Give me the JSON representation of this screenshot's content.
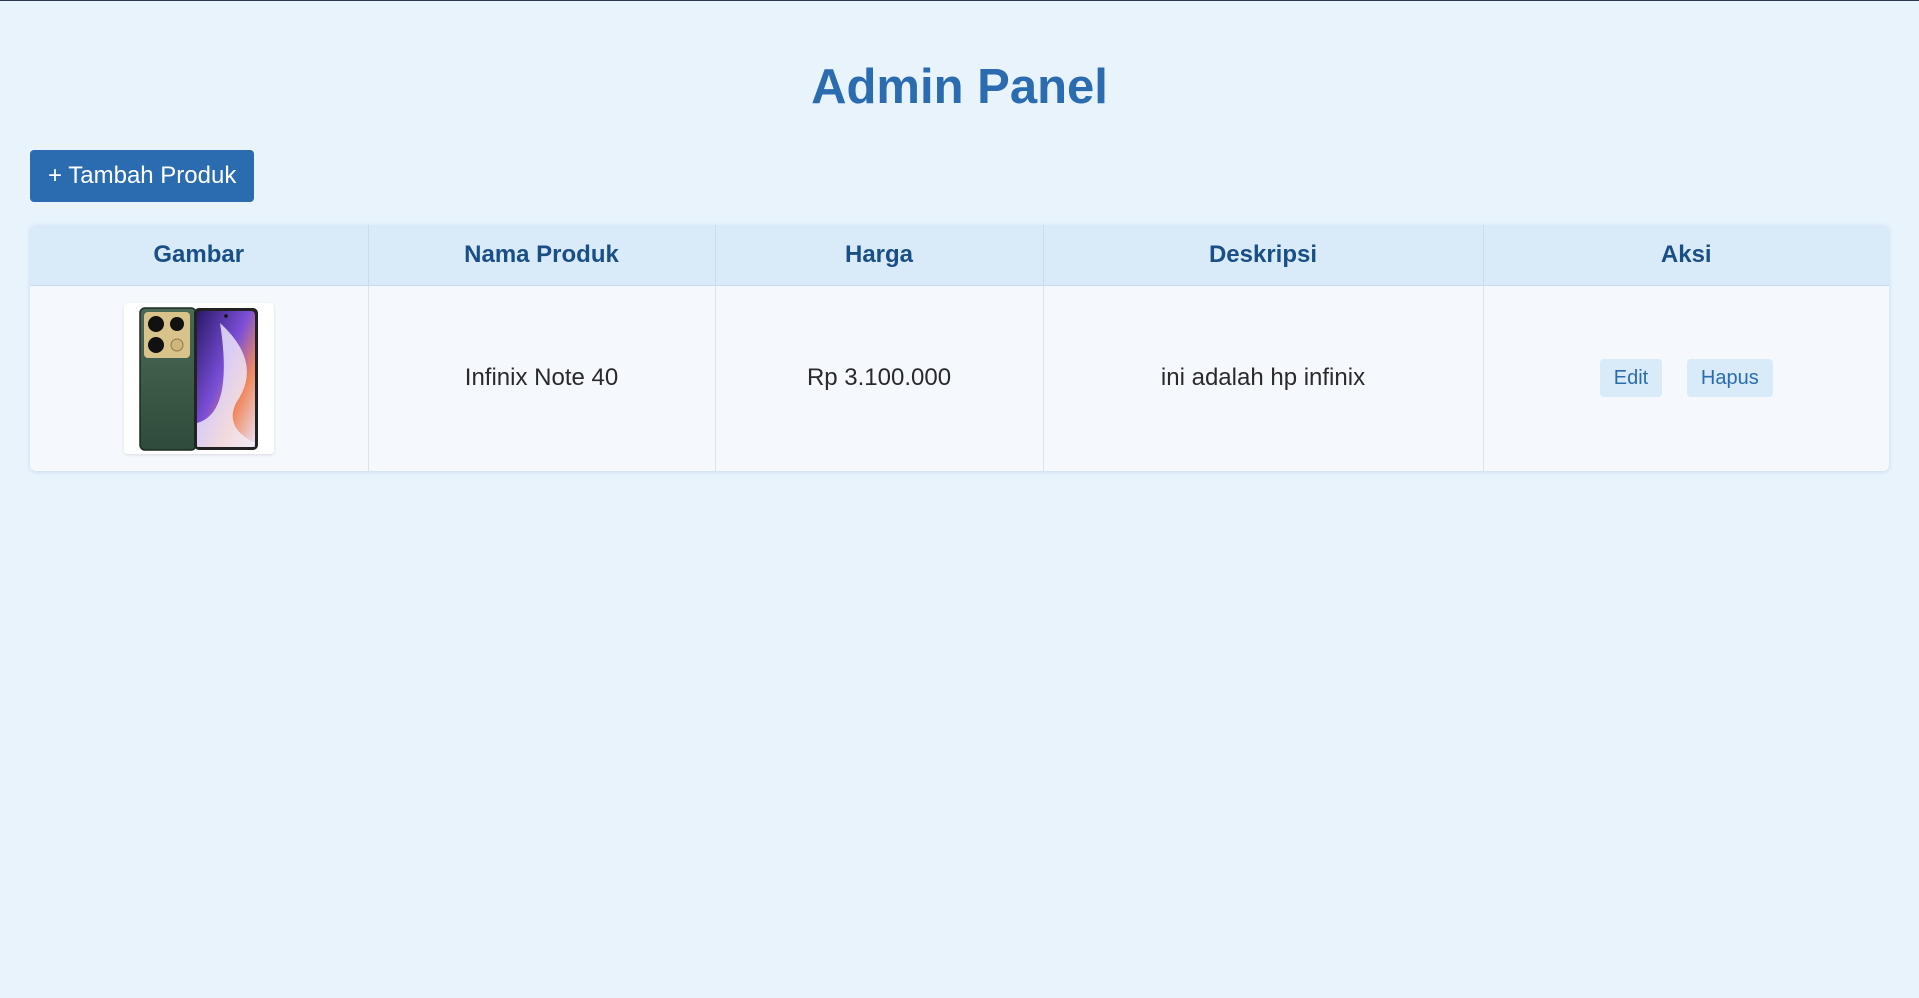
{
  "page": {
    "title": "Admin Panel"
  },
  "toolbar": {
    "add_label": "+ Tambah Produk"
  },
  "table": {
    "columns": [
      "Gambar",
      "Nama Produk",
      "Harga",
      "Deskripsi",
      "Aksi"
    ],
    "rows": [
      {
        "image_icon": "phone-image",
        "name": "Infinix Note 40",
        "price": "Rp 3.100.000",
        "description": "ini adalah hp infinix",
        "edit_label": "Edit",
        "delete_label": "Hapus"
      }
    ]
  },
  "colors": {
    "accent": "#2b6cb0",
    "background": "#e8f3fc",
    "header_bg": "#d9eaf9"
  }
}
